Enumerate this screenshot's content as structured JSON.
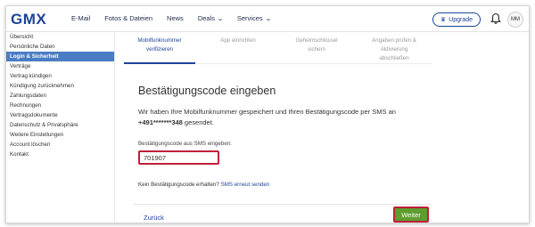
{
  "header": {
    "logo": "GMX",
    "nav": [
      {
        "label": "E-Mail",
        "dropdown": false
      },
      {
        "label": "Fotos & Dateien",
        "dropdown": false
      },
      {
        "label": "News",
        "dropdown": false
      },
      {
        "label": "Deals",
        "dropdown": true
      },
      {
        "label": "Services",
        "dropdown": true
      }
    ],
    "upgrade_label": "Upgrade",
    "upgrade_icon": "crown-icon",
    "bell_icon": "bell-icon",
    "avatar_initials": "MM"
  },
  "sidebar": {
    "items": [
      {
        "label": "Übersicht",
        "active": false
      },
      {
        "label": "Persönliche Daten",
        "active": false
      },
      {
        "label": "Login & Sicherheit",
        "active": true
      },
      {
        "label": "Verträge",
        "active": false
      },
      {
        "label": "Vertrag kündigen",
        "active": false
      },
      {
        "label": "Kündigung zurücknehmen",
        "active": false
      },
      {
        "label": "Zahlungsdaten",
        "active": false
      },
      {
        "label": "Rechnungen",
        "active": false
      },
      {
        "label": "Vertragsdokumente",
        "active": false
      },
      {
        "label": "Datenschutz & Privatsphäre",
        "active": false
      },
      {
        "label": "Weitere Einstellungen",
        "active": false
      },
      {
        "label": "Account löschen",
        "active": false
      },
      {
        "label": "Kontakt",
        "active": false
      }
    ]
  },
  "steps": [
    {
      "label_line1": "Mobilfunknummer",
      "label_line2": "verifizieren",
      "label_line3": "",
      "current": true
    },
    {
      "label_line1": "App einrichten",
      "label_line2": "",
      "label_line3": "",
      "current": false
    },
    {
      "label_line1": "Geheimschlüssel",
      "label_line2": "sichern",
      "label_line3": "",
      "current": false
    },
    {
      "label_line1": "Angaben prüfen &",
      "label_line2": "Aktivierung",
      "label_line3": "abschließen",
      "current": false
    }
  ],
  "main": {
    "heading": "Bestätigungscode eingeben",
    "para_prefix": "Wir haben Ihre Mobilfunknummer gespeichert und Ihren Bestätigungscode per SMS an",
    "phone": "+491*******348",
    "para_suffix": " gesendet.",
    "field_label": "Bestätigungscode aus SMS eingeben:",
    "code_value": "701907",
    "resend_text": "Kein Bestätigungscode erhalten?",
    "resend_link": "SMS erneut senden",
    "back_label": "Zurück",
    "next_label": "Weiter"
  },
  "colors": {
    "brand": "#1c449b",
    "active_sidebar": "#4a7cc4",
    "highlight": "#c0203a",
    "next_button": "#5f9d2f"
  }
}
